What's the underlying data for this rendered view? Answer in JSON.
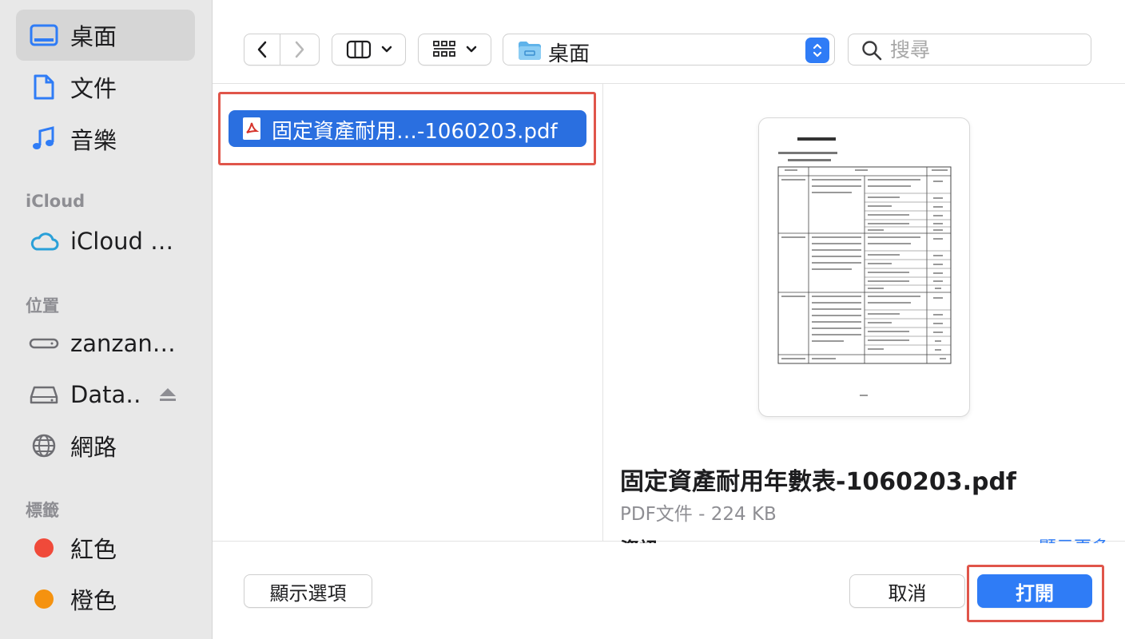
{
  "sidebar": {
    "favorites": [
      {
        "label": "桌面",
        "icon": "desktop-icon",
        "selected": true
      },
      {
        "label": "文件",
        "icon": "document-icon"
      },
      {
        "label": "音樂",
        "icon": "music-icon"
      }
    ],
    "icloud_header": "iCloud",
    "icloud_items": [
      {
        "label": "iCloud …",
        "icon": "cloud-icon"
      }
    ],
    "locations_header": "位置",
    "locations": [
      {
        "label": "zanzan…",
        "icon": "drive-icon"
      },
      {
        "label": "Data…",
        "icon": "disk-icon"
      },
      {
        "label": "網路",
        "icon": "globe-icon"
      }
    ],
    "tags_header": "標籤",
    "tags": [
      {
        "label": "紅色",
        "color": "#f04a3a"
      },
      {
        "label": "橙色",
        "color": "#f5920f"
      }
    ]
  },
  "toolbar": {
    "location": "桌面",
    "search_placeholder": "搜尋",
    "accent": "#2f7cf6"
  },
  "browser": {
    "selected_file": "固定資產耐用…-1060203.pdf"
  },
  "preview": {
    "file_name": "固定資產耐用年數表-1060203.pdf",
    "meta": "PDF文件 - 224 KB",
    "info_label": "資訊",
    "more_label": "顯示更多"
  },
  "footer": {
    "options_label": "顯示選項",
    "cancel_label": "取消",
    "open_label": "打開"
  }
}
